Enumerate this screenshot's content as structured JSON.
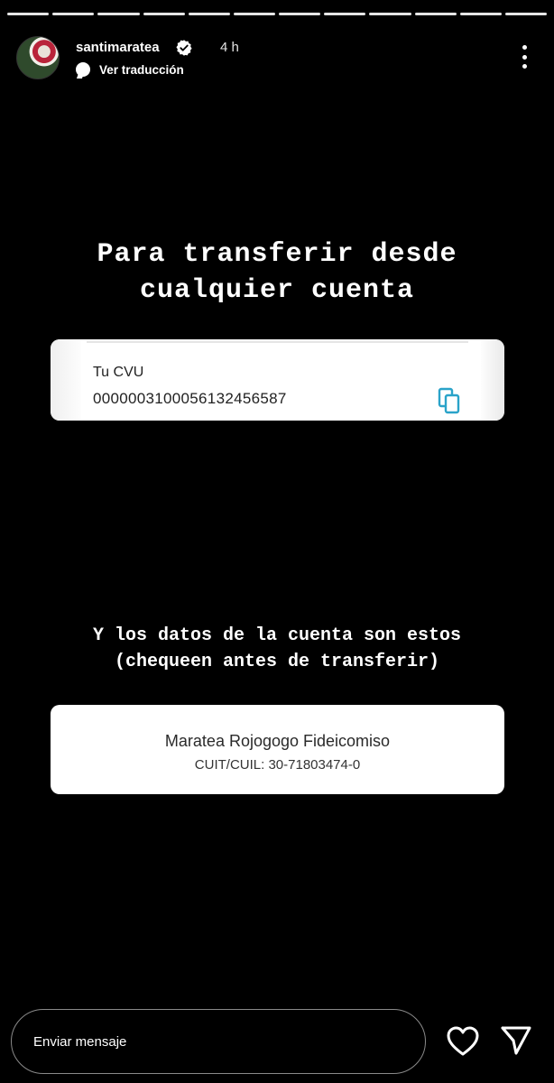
{
  "story": {
    "progress_segments": 12,
    "username": "santimaratea",
    "verified": true,
    "time": "4 h",
    "translate_label": "Ver traducción"
  },
  "content": {
    "heading1_line1": "Para transferir desde",
    "heading1_line2": "cualquier cuenta",
    "cvu_card": {
      "label": "Tu CVU",
      "number": "0000003100056132456587"
    },
    "heading2_line1": "Y los datos de la cuenta son estos",
    "heading2_line2": "(chequeen antes de transferir)",
    "account_card": {
      "name": "Maratea Rojogogo Fideicomiso",
      "cuit": "CUIT/CUIL: 30-71803474-0"
    }
  },
  "footer": {
    "message_placeholder": "Enviar mensaje"
  },
  "colors": {
    "background": "#000000",
    "copy_icon": "#2aa3c9",
    "verified_badge": "#ffffff"
  },
  "icons": [
    "verified-badge-icon",
    "translate-icon",
    "more-options-icon",
    "copy-icon",
    "heart-icon",
    "send-icon"
  ]
}
